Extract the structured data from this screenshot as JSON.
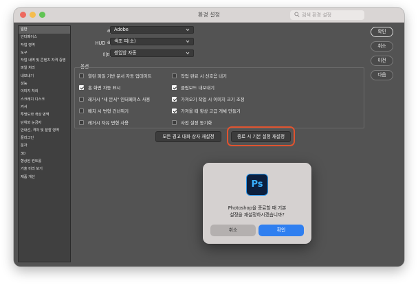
{
  "window": {
    "title": "환경 설정"
  },
  "search": {
    "placeholder": "검색 환경 설정"
  },
  "sidebar": {
    "items": [
      {
        "label": "일반"
      },
      {
        "label": "인터페이스"
      },
      {
        "label": "작업 영역"
      },
      {
        "label": "도구"
      },
      {
        "label": "작업 내역 및 콘텐츠 자격 증명"
      },
      {
        "label": "파일 처리"
      },
      {
        "label": "내보내기"
      },
      {
        "label": "성능"
      },
      {
        "label": "이미지 처리"
      },
      {
        "label": "스크래치 디스크"
      },
      {
        "label": "커서"
      },
      {
        "label": "투명도와 색상 영역"
      },
      {
        "label": "단위와 눈금자"
      },
      {
        "label": "안내선, 격자 및 분할 영역"
      },
      {
        "label": "플러그인"
      },
      {
        "label": "문자"
      },
      {
        "label": "3D"
      },
      {
        "label": "향상된 컨트롤"
      },
      {
        "label": "기술 미리 보기"
      },
      {
        "label": "제품 개선"
      }
    ]
  },
  "general": {
    "color_picker_label": "색상 피커:",
    "color_picker_value": "Adobe",
    "hud_picker_label": "HUD 색상 피커:",
    "hud_picker_value": "색조 띠(소)",
    "interp_label": "이미지 보간:",
    "interp_value": "쌍입방 자동"
  },
  "options": {
    "title": "옵션",
    "left": [
      {
        "label": "열린 파일 기반 문서 자동 업데이트",
        "checked": false
      },
      {
        "label": "홈 화면 자동 표시",
        "checked": true
      },
      {
        "label": "레거시 \"새 문서\" 인터페이스 사용",
        "checked": false
      },
      {
        "label": "배치 시 변형 건너뛰기",
        "checked": false
      },
      {
        "label": "레거시 자유 변형 사용",
        "checked": false
      }
    ],
    "right": [
      {
        "label": "작업 완료 시 신호음 내기",
        "checked": false
      },
      {
        "label": "클립보드 내보내기",
        "checked": true
      },
      {
        "label": "가져오기 작업 시 이미지 크기 조정",
        "checked": true
      },
      {
        "label": "가져올 때 항상 고급 개체 만들기",
        "checked": true
      },
      {
        "label": "사전 설정 동기화",
        "checked": false
      }
    ]
  },
  "buttons": {
    "reset_warnings": "모든 경고 대화 상자 재설정",
    "reset_on_quit": "종료 시 기본 설정 재설정"
  },
  "right_buttons": {
    "ok": "확인",
    "cancel": "취소",
    "prev": "이전",
    "next": "다음"
  },
  "dialog": {
    "icon_text": "Ps",
    "message_line1": "Photoshop을 종료할 때 기본",
    "message_line2": "설정을 재설정하시겠습니까?",
    "cancel": "취소",
    "confirm": "확인"
  },
  "colors": {
    "window_bg": "#535353",
    "highlight": "#e0532f",
    "primary_button": "#2f7ff0"
  }
}
